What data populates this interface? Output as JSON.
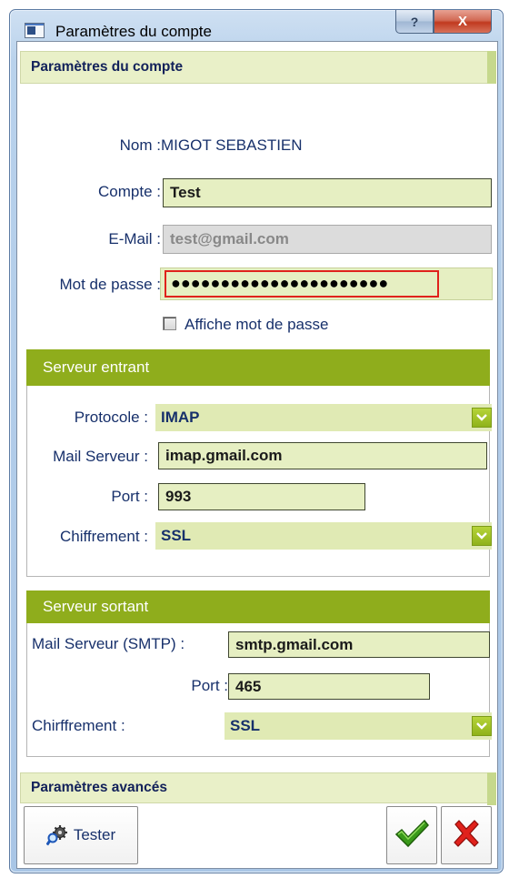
{
  "window": {
    "title": "Paramètres du compte",
    "help_glyph": "?",
    "close_glyph": "X"
  },
  "account_section": {
    "title": "Paramètres du compte"
  },
  "account": {
    "name_label": "Nom :",
    "name_value": "MIGOT SEBASTIEN",
    "account_label": "Compte :",
    "account_value": "Test",
    "email_label": "E-Mail :",
    "email_value": "test@gmail.com",
    "password_label": "Mot de passe :",
    "password_value": "●●●●●●●●●●●●●●●●●●●●●●",
    "show_password_label": "Affiche mot de passe",
    "show_password_checked": false
  },
  "incoming": {
    "title": "Serveur entrant",
    "protocol_label": "Protocole :",
    "protocol_value": "IMAP",
    "server_label": "Mail Serveur :",
    "server_value": "imap.gmail.com",
    "port_label": "Port :",
    "port_value": "993",
    "encryption_label": "Chiffrement :",
    "encryption_value": "SSL"
  },
  "outgoing": {
    "title": "Serveur sortant",
    "server_label": "Mail Serveur (SMTP) :",
    "server_value": "smtp.gmail.com",
    "port_label": "Port :",
    "port_value": "465",
    "encryption_label": "Chirffrement :",
    "encryption_value": "SSL"
  },
  "advanced_section": {
    "title": "Paramètres avancés"
  },
  "buttons": {
    "test_label": "Tester"
  },
  "colors": {
    "accent_green": "#8fad1c",
    "field_bg": "#e6efc2",
    "label_blue": "#17306b",
    "cancel_red": "#e0221c",
    "ok_green": "#3a9a1a"
  },
  "icons": {
    "window": "window-app-icon",
    "test": "gear-magnifier-icon",
    "ok": "checkmark-icon",
    "cancel": "red-x-icon",
    "dropdown": "chevron-down-icon"
  }
}
